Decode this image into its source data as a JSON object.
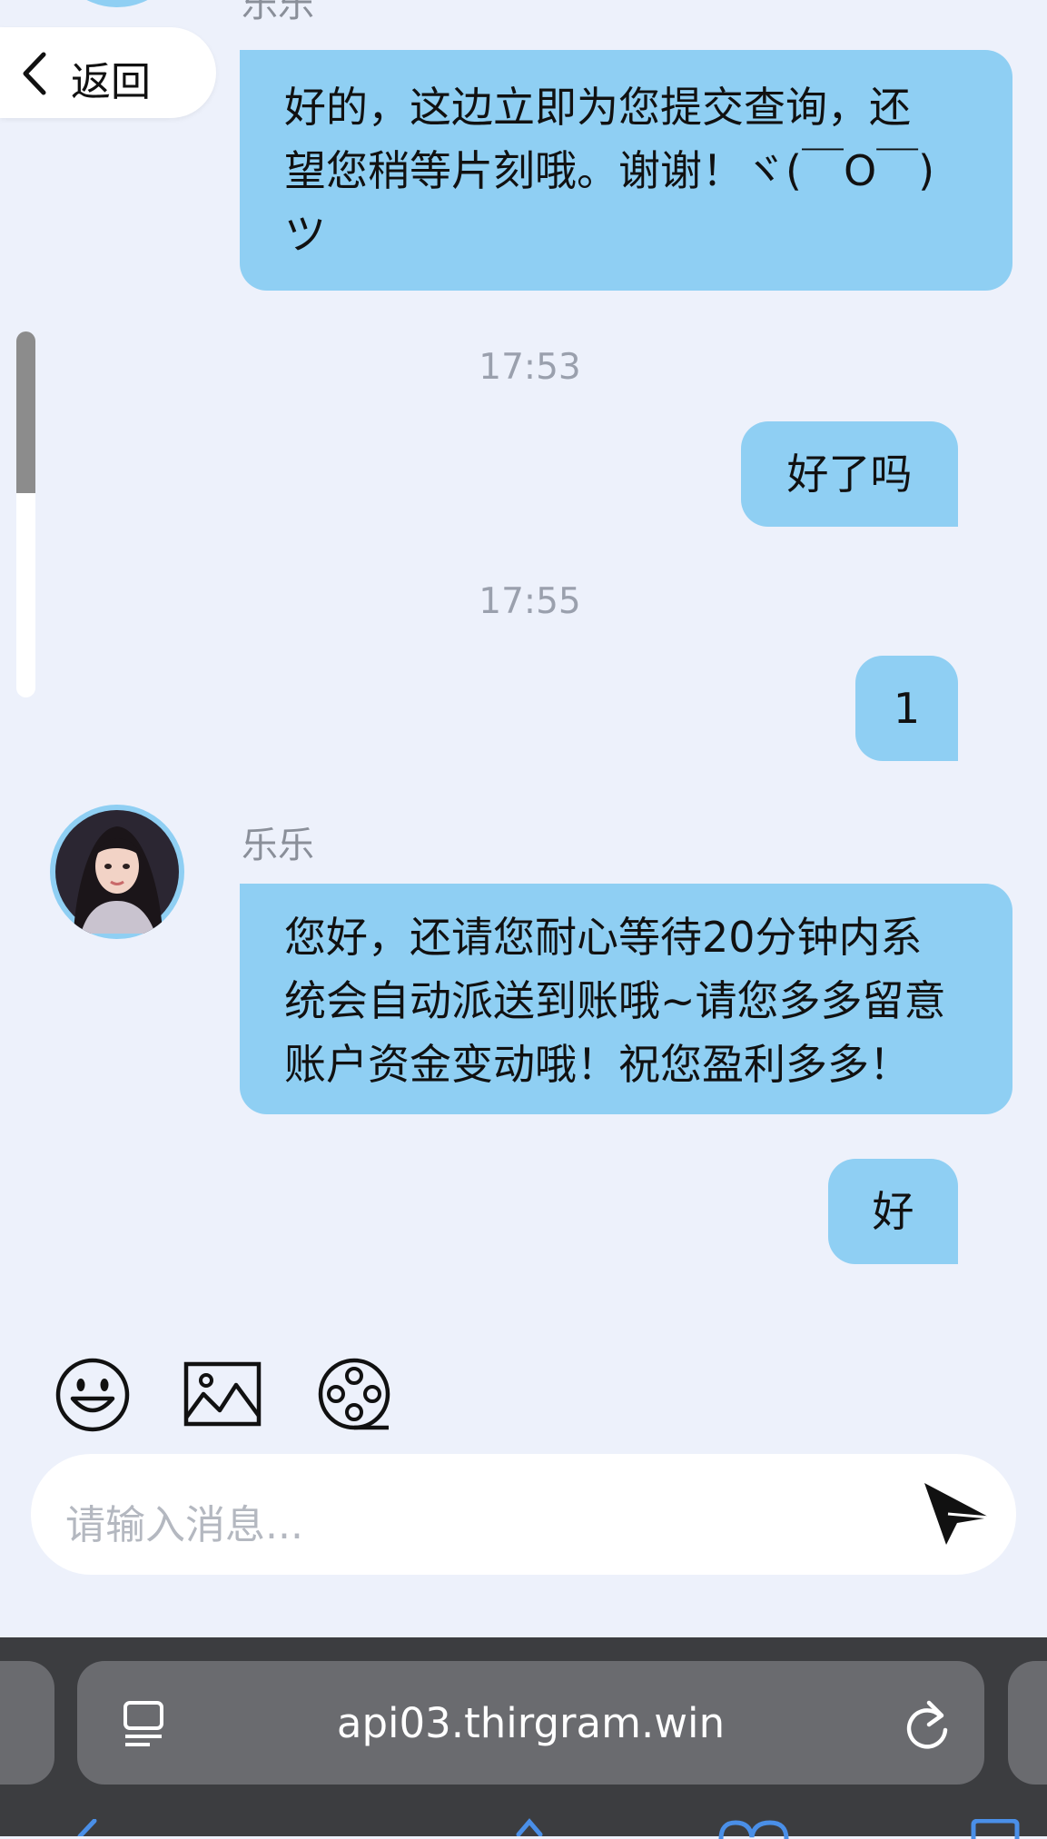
{
  "back": {
    "label": "返回"
  },
  "messages": {
    "m1_sender": "乐乐",
    "m1": [
      "好的，这边立即为您提交查询，还",
      "望您稍等片刻哦。谢谢！ヾ(￣O￣)",
      "ツ"
    ],
    "t1": "17:53",
    "m2": "好了吗",
    "t2": "17:55",
    "m3": "1",
    "m4_sender": "乐乐",
    "m4": [
      "您好，还请您耐心等待20分钟内系",
      "统会自动派送到账哦~请您多多留意",
      "账户资金变动哦！祝您盈利多多！"
    ],
    "m5": "好"
  },
  "toolbar": {
    "icons": [
      "emoji-icon",
      "image-icon",
      "video-icon"
    ]
  },
  "input": {
    "placeholder": "请输入消息..."
  },
  "browser": {
    "url": "api03.thirgram.win"
  },
  "colors": {
    "bubble": "#8fcff3",
    "background": "#edf1fb",
    "browser_bar": "#3c3d40"
  }
}
